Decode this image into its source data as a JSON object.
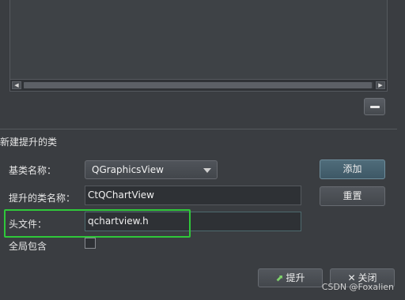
{
  "promote_section": {
    "title": "新建提升的类",
    "base_class_label": "基类名称：",
    "base_class_value": "QGraphicsView",
    "promoted_class_label": "提升的类名称：",
    "promoted_class_value": "CtQChartView",
    "header_file_label": "头文件：",
    "header_file_value": "qchartview.h",
    "global_include_label": "全局包含",
    "global_include_checked": false,
    "add_button": "添加",
    "reset_button": "重置"
  },
  "footer": {
    "promote_button": "提升",
    "close_button": "关闭",
    "watermark": "CSDN @Foxalien"
  },
  "colors": {
    "highlight": "#2fc83a",
    "background": "#3a3d41"
  },
  "icons": {
    "remove": "minus-icon",
    "promote": "promote-icon",
    "close": "close-icon"
  }
}
